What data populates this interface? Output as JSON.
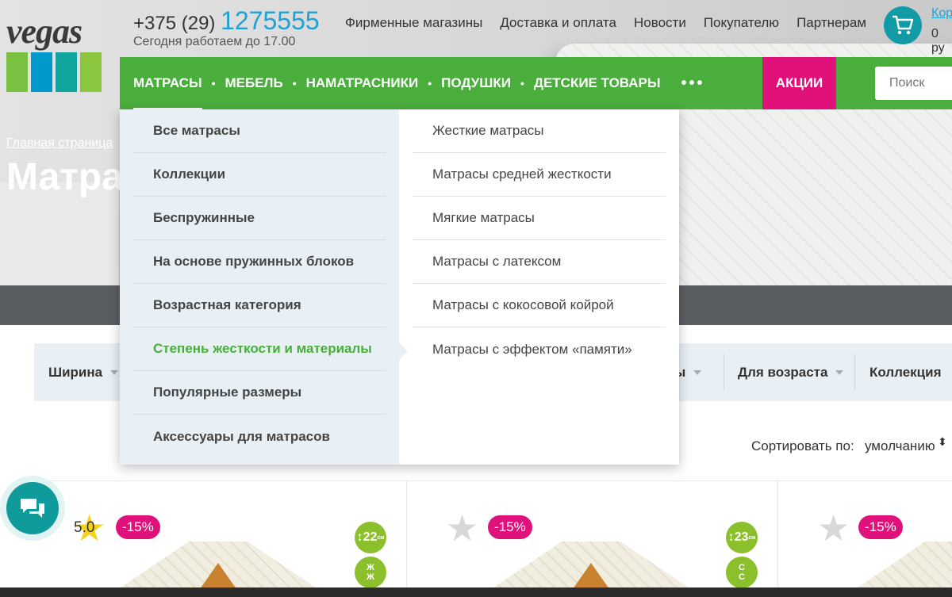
{
  "header": {
    "phone_prefix": "+375 (29)",
    "phone_number": "1275555",
    "hours": "Сегодня работаем до 17.00",
    "logo_text": "vegas",
    "logo_colors": [
      "#7ac142",
      "#0099cc",
      "#11a5a0",
      "#8cc63f"
    ],
    "top_nav": [
      "Фирменные магазины",
      "Доставка и оплата",
      "Новости",
      "Покупателю",
      "Партнерам"
    ],
    "cart_label": "Кор",
    "cart_sum": "0 ру"
  },
  "main_nav": {
    "items": [
      "МАТРАСЫ",
      "МЕБЕЛЬ",
      "НАМАТРАСНИКИ",
      "ПОДУШКИ",
      "ДЕТСКИЕ ТОВАРЫ"
    ],
    "more": "•••",
    "promo": "АКЦИИ",
    "search_placeholder": "Поиск",
    "color": "#4aae3c",
    "promo_color": "#e0117a"
  },
  "breadcrumb": "Главная страница",
  "page_title": "Матра",
  "dropdown": {
    "left": [
      "Все матрасы",
      "Коллекции",
      "Беспружинные",
      "На основе пружинных блоков",
      "Возрастная категория",
      "Степень жесткости и материалы",
      "Популярные размеры",
      "Аксессуары для матрасов"
    ],
    "active_index": 5,
    "right": [
      "Жесткие матрасы",
      "Матрасы средней жесткости",
      "Мягкие матрасы",
      "Матрасы с латексом",
      "Матрасы с кокосовой койрой",
      "Матрасы с эффектом «памяти»"
    ]
  },
  "filters": {
    "visible": [
      "Ширина",
      "лы",
      "Для возраста",
      "Коллекция"
    ]
  },
  "sort": {
    "label": "Сортировать по:",
    "value": "умолчанию",
    "arrows": "⬍"
  },
  "products": [
    {
      "rating": "5.0",
      "discount": "-15%",
      "height": "22",
      "firmness": [
        "Ж",
        "Ж"
      ]
    },
    {
      "discount": "-15%",
      "height": "23",
      "firmness": [
        "С",
        "С"
      ]
    },
    {
      "discount": "-15%"
    }
  ],
  "height_unit": "см"
}
